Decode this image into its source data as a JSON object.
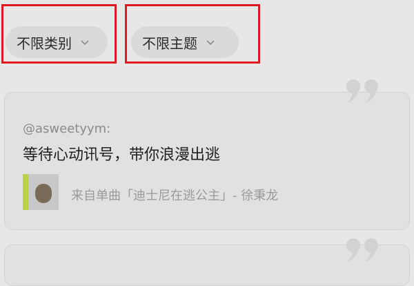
{
  "filters": {
    "category_label": "不限类别",
    "theme_label": "不限主题"
  },
  "card": {
    "username": "@asweetyym:",
    "content": "等待心动讯号，带你浪漫出逃",
    "source": "来自单曲「迪士尼在逃公主」- 徐秉龙"
  },
  "colors": {
    "highlight": "#e0191f",
    "background": "#e7e7e7"
  }
}
